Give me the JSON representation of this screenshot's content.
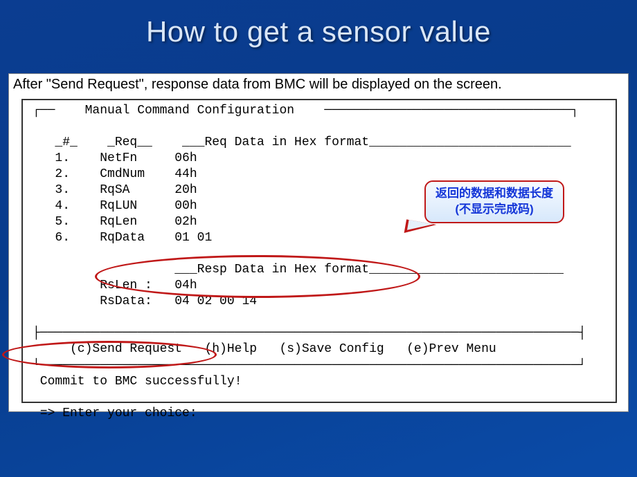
{
  "slide": {
    "title": "How to get a sensor value",
    "intro": "After \"Send Request\", response data from BMC will be displayed on the screen."
  },
  "terminal": {
    "config_title_line": "┌──    Manual Command Configuration    ─────────────────────────────────┐",
    "blank": " ",
    "col_hdr": "   _#_    _Req__    ___Req Data in Hex format___________________________",
    "r1": "   1.    NetFn     06h",
    "r2": "   2.    CmdNum    44h",
    "r3": "   3.    RqSA      20h",
    "r4": "   4.    RqLUN     00h",
    "r5": "   5.    RqLen     02h",
    "r6": "   6.    RqData    01 01",
    "resp_hdr": "                   ___Resp Data in Hex format__________________________",
    "resp1": "         RsLen :   04h",
    "resp2": "         RsData:   04 02 00 14",
    "menu_top": "├────────────────────────────────────────────────────────────────────────┤",
    "menu": "     (c)Send Request   (h)Help   (s)Save Config   (e)Prev Menu",
    "menu_bot": "└────────────────────────────────────────────────────────────────────────┘",
    "commit": " Commit to BMC successfully!",
    "prompt": " => Enter your choice:"
  },
  "callout": {
    "resp_line1": "返回的数据和数据长度",
    "resp_line2": "(不显示完成码)"
  }
}
